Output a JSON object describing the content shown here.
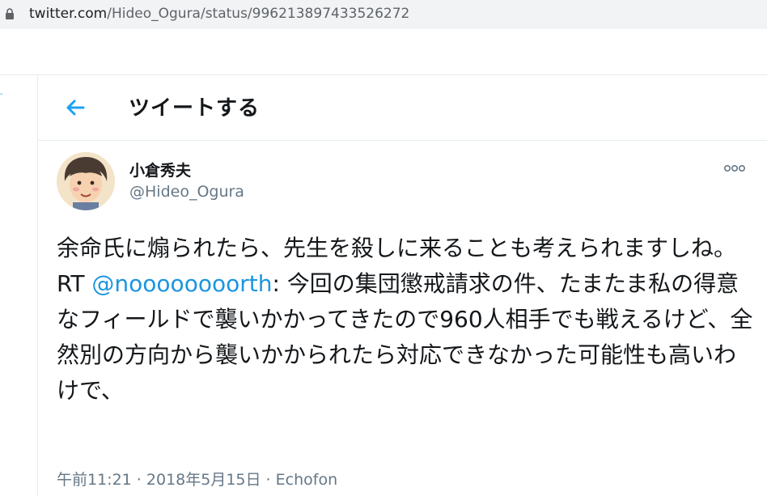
{
  "browser": {
    "url_host": "twitter.com",
    "url_path": "/Hideo_Ogura/status/996213897433526272"
  },
  "header": {
    "title": "ツイートする"
  },
  "tweet": {
    "author_name": "小倉秀夫",
    "author_handle": "@Hideo_Ogura",
    "text_before_mention": "余命氏に煽られたら、先生を殺しに来ることも考えられますしね。RT ",
    "mention": "@noooooooorth",
    "text_after_mention": ": 今回の集団懲戒請求の件、たまたま私の得意なフィールドで襲いかかってきたので960人相手でも戦えるけど、全然別の方向から襲いかかられたら対応できなかった可能性も高いわけで、",
    "time": "午前11:21",
    "separator1": " · ",
    "date": "2018年5月15日",
    "separator2": " · ",
    "source": "Echofon"
  },
  "colors": {
    "accent": "#1da1f2",
    "mention": "#1b95e0",
    "text": "#14171a",
    "secondary": "#657786"
  },
  "icons": {
    "lock": "lock-icon",
    "back": "arrow-left-icon",
    "more": "more-horizontal-icon"
  }
}
